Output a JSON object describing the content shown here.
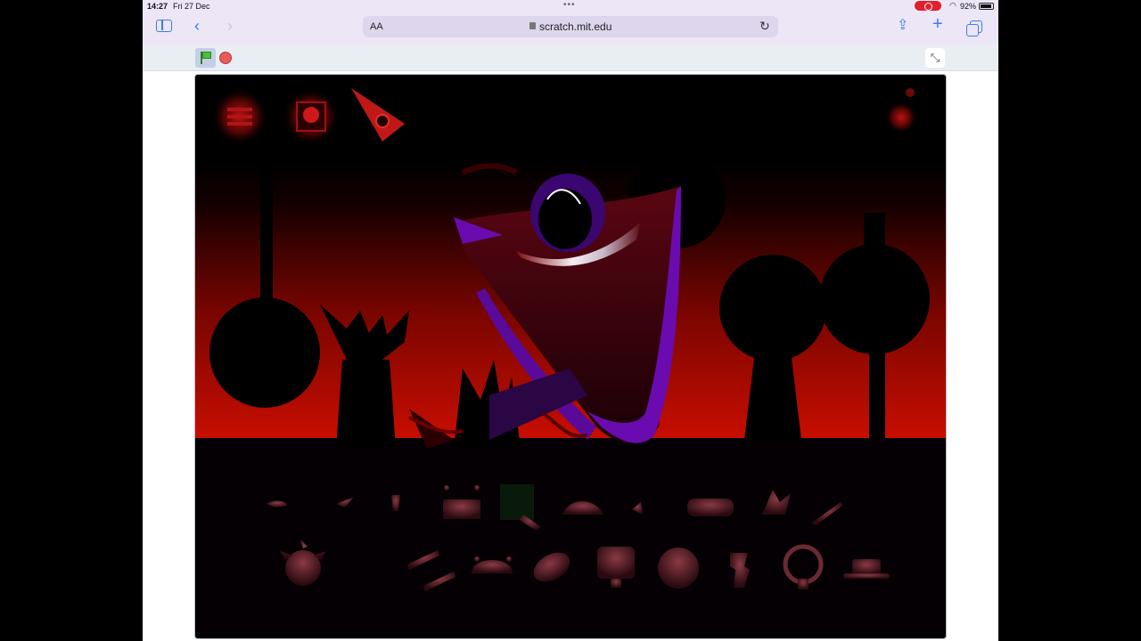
{
  "status_bar": {
    "time": "14:27",
    "date": "Fri 27 Dec",
    "dots": "•••",
    "battery_percent": "92%"
  },
  "toolbar": {
    "text_size_label": "AA",
    "url": "scratch.mit.edu"
  },
  "colors": {
    "toolbar_bg": "#ece6f7",
    "accent": "#3b7de8",
    "recording": "#e0202c",
    "flag": "#4cbf3c",
    "stop": "#ec5959",
    "sky_red": "#c00c00",
    "creature_purple": "#6a0bb0"
  },
  "icons": {
    "sidebar": "sidebar-icon",
    "back": "chevron-left-icon",
    "forward": "chevron-right-icon",
    "reload": "reload-icon",
    "share": "share-icon",
    "new_tab": "plus-icon",
    "tabs": "tabs-icon",
    "green_flag": "green-flag-icon",
    "stop": "stop-icon",
    "exit_fullscreen": "exit-fullscreen-icon"
  }
}
